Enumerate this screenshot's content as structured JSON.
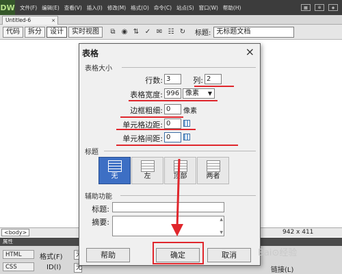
{
  "app": {
    "logo": "DW",
    "menus": [
      "文件(F)",
      "编辑(E)",
      "查看(V)",
      "插入(I)",
      "修改(M)",
      "格式(O)",
      "命令(C)",
      "站点(S)",
      "窗口(W)",
      "帮助(H)"
    ]
  },
  "doc_tab": {
    "name": "Untitled-6",
    "close": "×"
  },
  "view_toolbar": {
    "buttons": [
      "代码",
      "拆分",
      "设计",
      "实时视图"
    ],
    "active_view": "设计",
    "title_label": "标题:",
    "title_value": "无标题文档"
  },
  "status_bar": {
    "tag": "<body>",
    "size": "942 x 411"
  },
  "properties_panel": {
    "header": "属性",
    "tabs": [
      "HTML",
      "CSS"
    ],
    "format_label": "格式(F)",
    "format_value": "无",
    "id_label": "ID(I)",
    "id_value": "无",
    "link_label": "链接(L)"
  },
  "dialog": {
    "title": "表格",
    "close": "×",
    "size_group": "表格大小",
    "rows_label": "行数:",
    "rows_value": "3",
    "cols_label": "列:",
    "cols_value": "2",
    "width_label": "表格宽度:",
    "width_value": "996",
    "width_unit": "像素",
    "border_label": "边框粗细:",
    "border_value": "0",
    "border_unit": "像素",
    "padding_label": "单元格边距:",
    "padding_value": "0",
    "spacing_label": "单元格间距:",
    "spacing_value": "0",
    "header_group": "标题",
    "header_options": [
      "无",
      "左",
      "顶部",
      "两者"
    ],
    "header_selected": "无",
    "access_group": "辅助功能",
    "caption_label": "标题:",
    "caption_value": "",
    "summary_label": "摘要:",
    "summary_value": "",
    "help_button": "帮助",
    "ok_button": "确定",
    "cancel_button": "取消"
  },
  "colors": {
    "annotation_red": "#e0262c",
    "selected_blue": "#3d6fc4"
  }
}
